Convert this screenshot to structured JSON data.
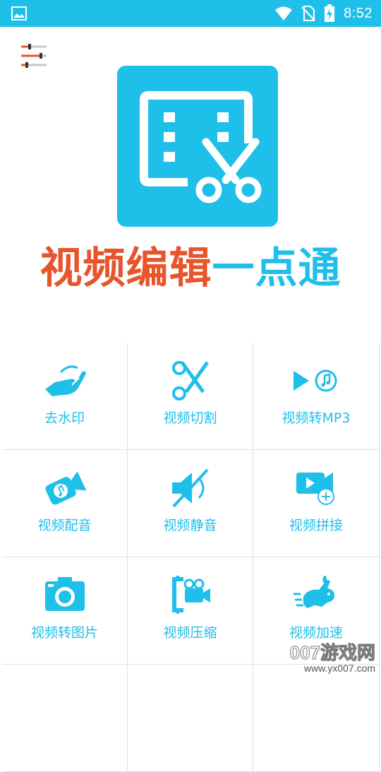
{
  "status_bar": {
    "time": "8:52",
    "icons": [
      "image-icon",
      "wifi-icon",
      "no-sim-icon",
      "battery-charging-icon"
    ]
  },
  "header": {
    "settings_icon": "sliders-icon",
    "logo_icon": "film-scissors-icon",
    "title_part1": "视频编辑",
    "title_part2": "一点通"
  },
  "features": [
    {
      "label": "去水印",
      "icon": "hand-wipe-icon"
    },
    {
      "label": "视频切割",
      "icon": "scissors-icon"
    },
    {
      "label": "视频转MP3",
      "icon": "play-music-icon"
    },
    {
      "label": "视频配音",
      "icon": "camera-music-icon"
    },
    {
      "label": "视频静音",
      "icon": "mute-speaker-icon"
    },
    {
      "label": "视频拼接",
      "icon": "video-add-icon"
    },
    {
      "label": "视频转图片",
      "icon": "photo-camera-icon"
    },
    {
      "label": "视频压缩",
      "icon": "compress-clamp-icon"
    },
    {
      "label": "视频加速",
      "icon": "rabbit-fast-icon"
    }
  ],
  "watermark": {
    "brand": "007游戏网",
    "url": "www.yx007.com"
  },
  "colors": {
    "accent": "#1ebfe9",
    "title_orange": "#e8542b"
  }
}
